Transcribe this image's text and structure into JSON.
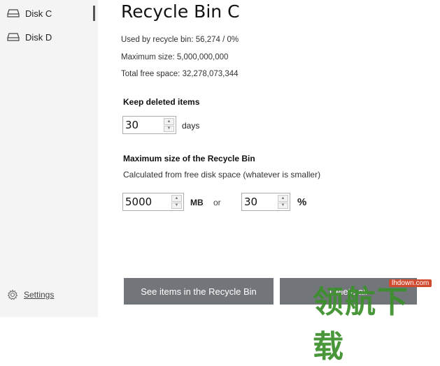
{
  "sidebar": {
    "items": [
      {
        "label": "Disk C",
        "icon": "drive-icon",
        "active": true
      },
      {
        "label": "Disk D",
        "icon": "drive-icon",
        "active": false
      }
    ],
    "settings_label": "Settings"
  },
  "main": {
    "title": "Recycle Bin C",
    "used": "Used by recycle bin: 56,274 / 0%",
    "max_size": "Maximum size: 5,000,000,000",
    "free_space": "Total free space: 32,278,073,344",
    "keep": {
      "heading": "Keep deleted items",
      "value": "30",
      "unit": "days"
    },
    "max": {
      "heading": "Maximum size of the Recycle Bin",
      "subtitle": "Calculated from free disk space (whatever is smaller)",
      "mb_value": "5000",
      "mb_unit": "MB",
      "or_label": "or",
      "pct_value": "30",
      "pct_unit": "%"
    }
  },
  "buttons": {
    "see_items": "See items in the Recycle Bin",
    "empty_all": "Delete all"
  },
  "watermark": {
    "text": "领航下载",
    "url": "lhdown.com"
  },
  "colors": {
    "button_bg": "#72767a",
    "sidebar_bg": "#f4f4f4",
    "active_bar": "#555555",
    "watermark_green": "#3a8f2a"
  }
}
